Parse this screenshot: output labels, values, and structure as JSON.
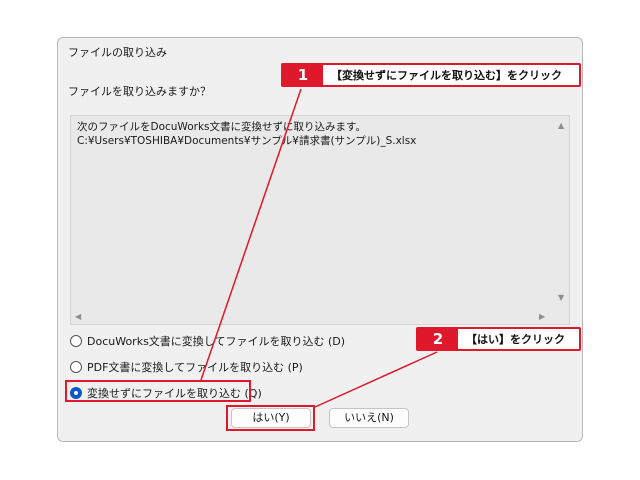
{
  "dialog": {
    "title": "ファイルの取り込み",
    "question": "ファイルを取り込みますか？",
    "message_line1": "次のファイルをDocuWorks文書に変換せずに取り込みます。",
    "message_line2": "C:¥Users¥TOSHIBA¥Documents¥サンプル¥請求書(サンプル)_S.xlsx",
    "options": [
      {
        "label": "DocuWorks文書に変換してファイルを取り込む (D)",
        "selected": false
      },
      {
        "label": "PDF文書に変換してファイルを取り込む (P)",
        "selected": false
      },
      {
        "label": "変換せずにファイルを取り込む (Q)",
        "selected": true
      }
    ],
    "yes_button": "はい(Y)",
    "no_button": "いいえ(N)"
  },
  "callouts": [
    {
      "number": "1",
      "text": "【変換せずにファイルを取り込む】をクリック"
    },
    {
      "number": "2",
      "text": "【はい】をクリック"
    }
  ],
  "colors": {
    "accent": "#e0182b",
    "radio_selected": "#0b59c6"
  }
}
